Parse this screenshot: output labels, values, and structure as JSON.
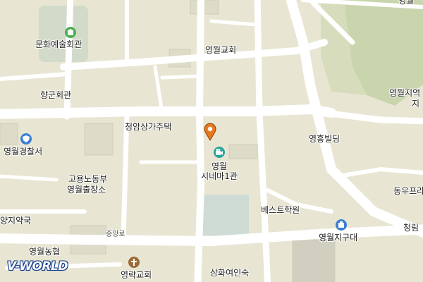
{
  "map": {
    "labels": {
      "culture_center": "문화예술회관",
      "church_top": "영월교회",
      "hyanggyo": "향군회관",
      "police": "영월경찰서",
      "cheongam": "청암상가주택",
      "employment_1": "고용노동부",
      "employment_2": "영월출장소",
      "yangji": "양지약국",
      "cinema_1": "영월",
      "cinema_2": "시네마1관",
      "best_academy": "베스트학원",
      "district_unit": "영월지구대",
      "nonghyup": "영월농협",
      "yeongnak": "영락교회",
      "samhwa": "삼화여인숙",
      "yeongheung": "영흥빌딩",
      "dongu": "동우프라",
      "yeongwol_station_1": "영월지역",
      "yeongwol_station_2": "지",
      "cheongnim": "청림",
      "road_jungangro": "중앙로",
      "top_right_partial": "영월"
    },
    "colors": {
      "background": "#e8e6d3",
      "road": "#ffffff",
      "park": "#c9d5ad",
      "water": "#cfdcd6",
      "building": "#dddcc8",
      "pin": "#e8781c",
      "poi_culture": "#4caf50",
      "poi_police": "#3b7fd6",
      "poi_cinema": "#26a69a",
      "poi_church": "#9c6b3a"
    },
    "icons": {
      "culture": "culture-center-icon",
      "police": "police-icon",
      "cinema": "cinema-icon",
      "church": "church-icon",
      "district_unit": "police-box-icon",
      "pin": "location-pin-icon"
    },
    "logo": "V-WORLD"
  }
}
